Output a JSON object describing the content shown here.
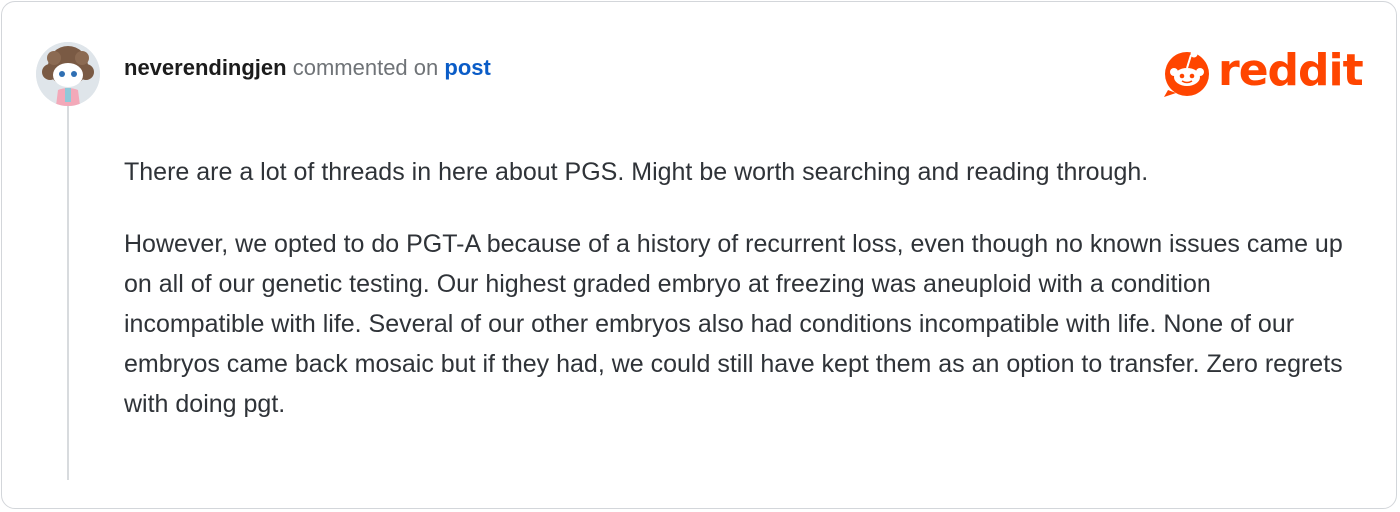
{
  "comment": {
    "username": "neverendingjen",
    "action_text": "commented on",
    "post_link_label": "post",
    "paragraphs": [
      "There are a lot of threads in here about PGS. Might be worth searching and reading through.",
      "However, we opted to do PGT-A because of a history of recurrent loss, even though no known issues came up on all of our genetic testing. Our highest graded embryo at freezing was aneuploid with a condition incompatible with life. Several of our other embryos also had conditions incompatible with life. None of our embryos came back mosaic but if they had, we could still have kept them as an option to transfer. Zero regrets with doing pgt."
    ]
  },
  "brand": {
    "logo_text": "reddit",
    "color": "#ff4500"
  },
  "icons": {
    "avatar": "snoo-avatar",
    "logo": "reddit-snoo-icon"
  }
}
